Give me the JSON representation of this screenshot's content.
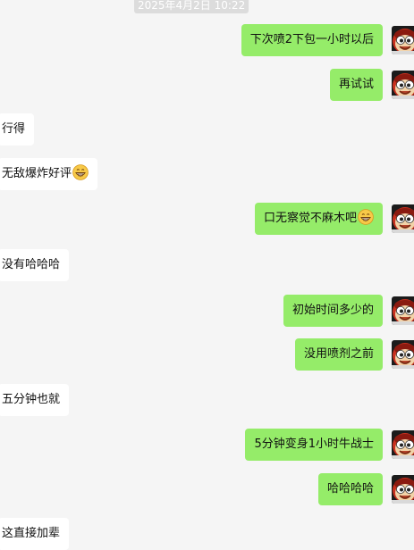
{
  "timestamp": "2025年4月2日 10:22",
  "colors": {
    "background": "#f5f5f5",
    "outgoing_bubble": "#95ec69",
    "incoming_bubble": "#ffffff"
  },
  "avatar_icon": "monkey-avatar-icon",
  "emoji_icon": "grinning-face-icon",
  "messages": [
    {
      "side": "out",
      "text": "下次喷2下包一小时以后",
      "emoji": false
    },
    {
      "side": "out",
      "text": "再试试",
      "emoji": false
    },
    {
      "side": "in",
      "text": "行得",
      "emoji": false
    },
    {
      "side": "in",
      "text": "无敌爆炸好评",
      "emoji": true
    },
    {
      "side": "out",
      "text": "口无察觉不麻木吧",
      "emoji": true
    },
    {
      "side": "in",
      "text": "没有哈哈哈",
      "emoji": false
    },
    {
      "side": "out",
      "text": "初始时间多少的",
      "emoji": false
    },
    {
      "side": "out",
      "text": "没用喷剂之前",
      "emoji": false
    },
    {
      "side": "in",
      "text": "五分钟也就",
      "emoji": false
    },
    {
      "side": "out",
      "text": "5分钟变身1小时牛战士",
      "emoji": false
    },
    {
      "side": "out",
      "text": "哈哈哈哈",
      "emoji": false
    },
    {
      "side": "in",
      "text": "这直接加辈",
      "emoji": false
    }
  ]
}
